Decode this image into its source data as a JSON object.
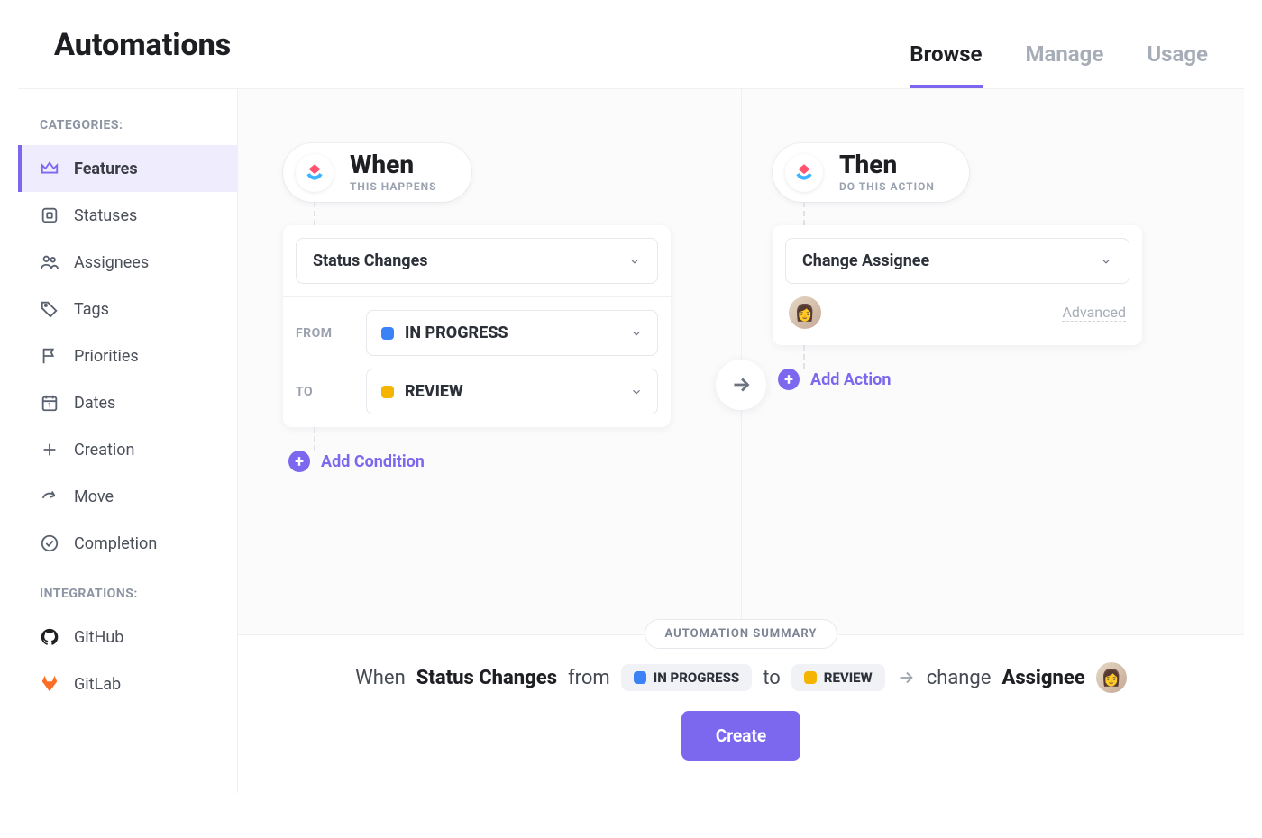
{
  "header": {
    "title": "Automations"
  },
  "tabs": {
    "browse": "Browse",
    "manage": "Manage",
    "usage": "Usage",
    "active": "browse"
  },
  "sidebar": {
    "categories_label": "CATEGORIES:",
    "integrations_label": "INTEGRATIONS:",
    "items": [
      {
        "label": "Features",
        "icon": "crown",
        "active": true
      },
      {
        "label": "Statuses",
        "icon": "square"
      },
      {
        "label": "Assignees",
        "icon": "people"
      },
      {
        "label": "Tags",
        "icon": "tag"
      },
      {
        "label": "Priorities",
        "icon": "flag"
      },
      {
        "label": "Dates",
        "icon": "calendar"
      },
      {
        "label": "Creation",
        "icon": "plus"
      },
      {
        "label": "Move",
        "icon": "share"
      },
      {
        "label": "Completion",
        "icon": "check"
      }
    ],
    "integrations": [
      {
        "label": "GitHub",
        "icon": "github"
      },
      {
        "label": "GitLab",
        "icon": "gitlab"
      }
    ]
  },
  "when": {
    "title": "When",
    "subtitle": "THIS HAPPENS",
    "trigger": "Status Changes",
    "from_label": "FROM",
    "from_value": "IN PROGRESS",
    "from_color": "#3b82f6",
    "to_label": "TO",
    "to_value": "REVIEW",
    "to_color": "#f5b400",
    "add_condition": "Add Condition"
  },
  "then": {
    "title": "Then",
    "subtitle": "DO THIS ACTION",
    "action": "Change Assignee",
    "advanced": "Advanced",
    "add_action": "Add Action"
  },
  "summary": {
    "pill": "AUTOMATION SUMMARY",
    "when": "When",
    "status_changes": "Status Changes",
    "from": "from",
    "in_progress": "IN PROGRESS",
    "to": "to",
    "review": "REVIEW",
    "change": "change",
    "assignee": "Assignee"
  },
  "create_button": "Create",
  "colors": {
    "accent": "#7b68ee"
  }
}
